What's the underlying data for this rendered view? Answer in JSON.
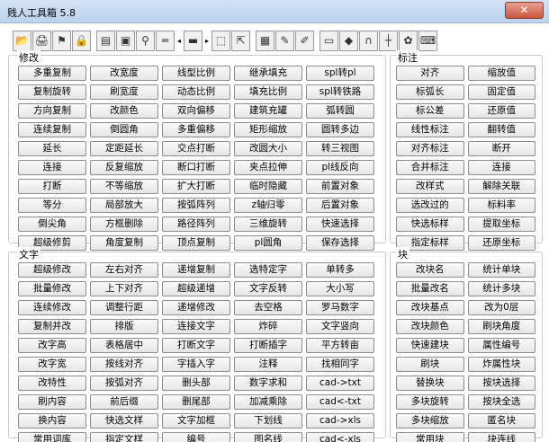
{
  "window": {
    "title": "贱人工具箱 5.8",
    "close_label": "✕"
  },
  "toolbar": {
    "icons": [
      "folder-open-icon",
      "print-icon",
      "stamp-icon",
      "lock-icon",
      "calculator-icon",
      "window-icon",
      "magnifier-icon",
      "measure-icon",
      "arrow-left-icon",
      "layer-icon",
      "arrow-right-icon",
      "select-icon",
      "export-icon",
      "image-icon",
      "pen-icon",
      "edit-icon",
      "screen-icon",
      "cube-icon",
      "magnet-icon",
      "crosshair-icon",
      "settings-icon",
      "keyboard-icon"
    ],
    "glyphs": [
      "📂",
      "🖨",
      "⚑",
      "🔒",
      "▤",
      "▣",
      "⚲",
      "═",
      "◂",
      "▬",
      "▸",
      "⬚",
      "⇱",
      "▦",
      "✎",
      "✐",
      "▭",
      "◆",
      "∩",
      "┼",
      "✿",
      "⌨"
    ]
  },
  "sections": {
    "modify": {
      "label": "修改",
      "buttons": [
        "多重复制",
        "改宽度",
        "线型比例",
        "继承填充",
        "spl转pl",
        "复制旋转",
        "刷宽度",
        "动态比例",
        "填充比例",
        "spl转铁路",
        "方向复制",
        "改颜色",
        "双向偏移",
        "建筑充罐",
        "弧转圆",
        "连续复制",
        "倒圆角",
        "多重偏移",
        "矩形缩放",
        "圆转多边",
        "延长",
        "定距延长",
        "交点打断",
        "改圆大小",
        "转三视图",
        "连接",
        "反复缩放",
        "断口打断",
        "夹点拉伸",
        "pl线反向",
        "打断",
        "不等缩放",
        "扩大打断",
        "临时隐藏",
        "前置对象",
        "等分",
        "局部放大",
        "按弧阵列",
        "z轴归零",
        "后置对象",
        "倒尖角",
        "方框删除",
        "路径阵列",
        "三维旋转",
        "快速选择",
        "超级修剪",
        "角度复制",
        "顶点复制",
        "pl圆角",
        "保存选择"
      ]
    },
    "annotation": {
      "label": "标注",
      "buttons": [
        "对齐",
        "缩放值",
        "标弧长",
        "固定值",
        "标公差",
        "还原值",
        "线性标注",
        "翻转值",
        "对齐标注",
        "断开",
        "合并标注",
        "连接",
        "改样式",
        "解除关联",
        "选改过的",
        "标料率",
        "快选标样",
        "提取坐标",
        "指定标样",
        "还原坐标"
      ]
    },
    "text": {
      "label": "文字",
      "buttons": [
        "超级修改",
        "左右对齐",
        "递增复制",
        "选特定字",
        "单转多",
        "批量修改",
        "上下对齐",
        "超级递增",
        "文字反转",
        "大小写",
        "连续修改",
        "调整行距",
        "递增修改",
        "去空格",
        "罗马数字",
        "复制并改",
        "排版",
        "连接文字",
        "炸碎",
        "文字竖向",
        "改字高",
        "表格居中",
        "打断文字",
        "打断插字",
        "平方转亩",
        "改字宽",
        "按线对齐",
        "字插入字",
        "注释",
        "找相同字",
        "改特性",
        "按弧对齐",
        "删头部",
        "数字求和",
        "cad->txt",
        "刷内容",
        "前后缀",
        "删尾部",
        "加减乘除",
        "cad<-txt",
        "换内容",
        "快选文样",
        "文字加框",
        "下划线",
        "cad->xls",
        "常用词库",
        "指定文样",
        "编号",
        "图名线",
        "cad<-xls"
      ]
    },
    "block": {
      "label": "块",
      "buttons": [
        "改块名",
        "统计单块",
        "批量改名",
        "统计多块",
        "改块基点",
        "改为0层",
        "改块颜色",
        "刷块角度",
        "快速建块",
        "属性编号",
        "刷块",
        "炸属性块",
        "替换块",
        "按块选择",
        "多块旋转",
        "按块全选",
        "多块缩放",
        "匿名块",
        "常用块",
        "块连线"
      ]
    }
  }
}
